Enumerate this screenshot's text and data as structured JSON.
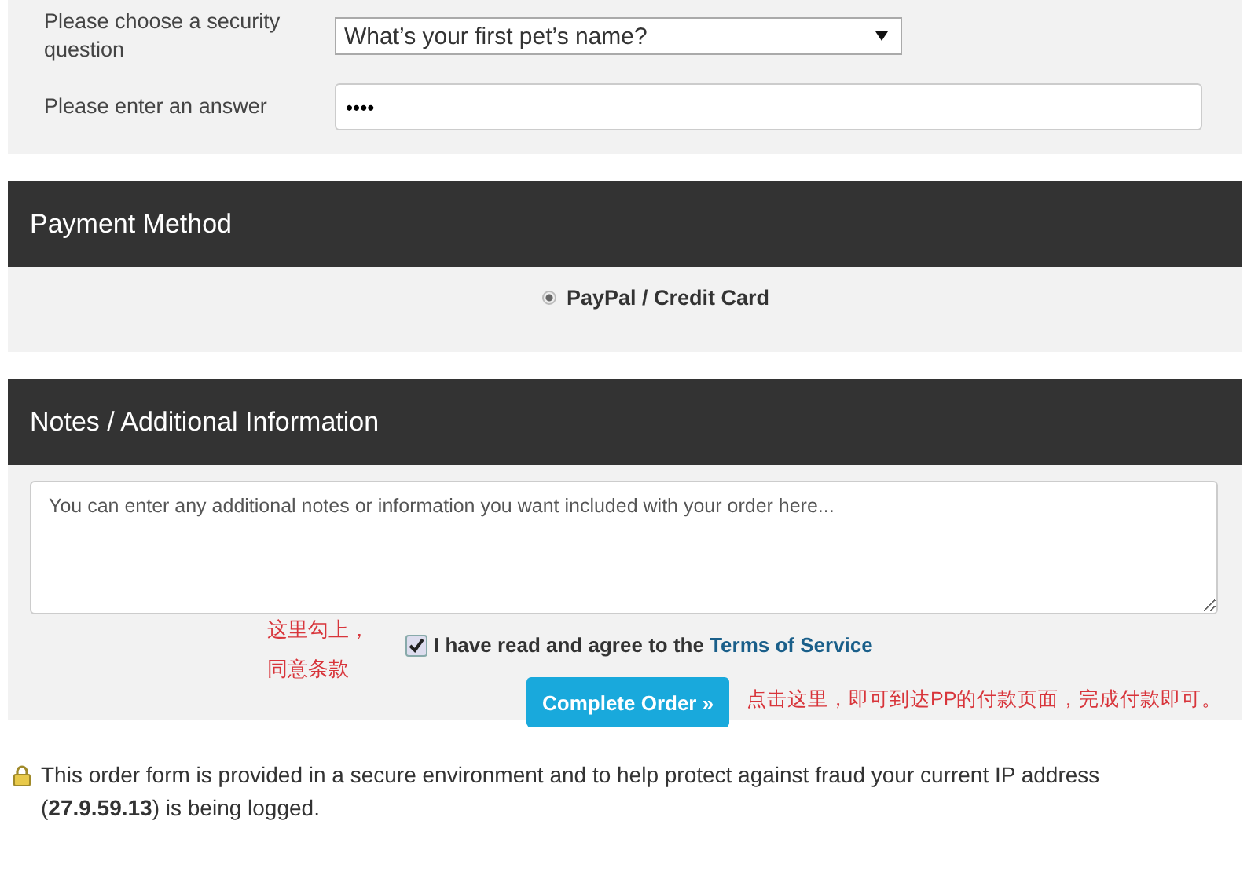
{
  "security": {
    "question_label": "Please choose a security question",
    "question_value": "What’s your first pet’s name?",
    "answer_label": "Please enter an answer",
    "answer_value": "••••"
  },
  "payment": {
    "title": "Payment Method",
    "options": [
      {
        "label": "PayPal / Credit Card",
        "selected": true
      }
    ]
  },
  "notes": {
    "title": "Notes / Additional Information",
    "placeholder": "You can enter any additional notes or information you want included with your order here...",
    "agree": {
      "checked": true,
      "text": "I have read and agree to the ",
      "link": "Terms of Service"
    },
    "button": "Complete Order »"
  },
  "annotations": [
    {
      "kind": "left",
      "lines": [
        "这里勾上，",
        "同意条款"
      ]
    },
    {
      "kind": "right",
      "lines": [
        "点击这里，即可到达PP的付款页面，完成付款即可。"
      ]
    }
  ],
  "footer": {
    "text": "This order form is provided in a secure environment and to help protect against fraud your current IP address (**27.9.59.13**) is being logged."
  }
}
